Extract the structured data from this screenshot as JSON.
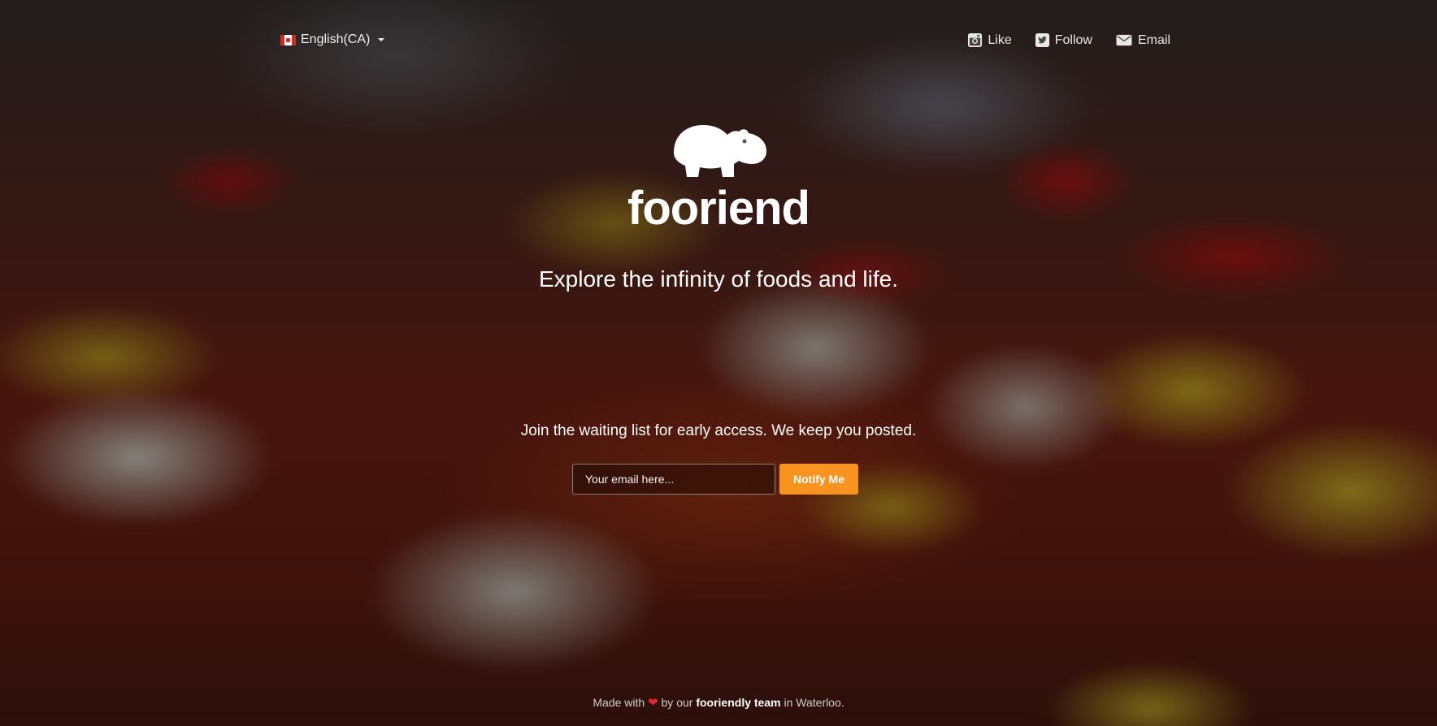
{
  "header": {
    "language": {
      "label": "English(CA)",
      "flag": "canada-flag-icon"
    },
    "social": [
      {
        "label": "Like",
        "icon": "instagram-icon"
      },
      {
        "label": "Follow",
        "icon": "twitter-icon"
      },
      {
        "label": "Email",
        "icon": "envelope-icon"
      }
    ]
  },
  "hero": {
    "brand": "fooriend",
    "tagline": "Explore the infinity of foods and life."
  },
  "signup": {
    "prompt": "Join the waiting list for early access. We keep you posted.",
    "email_placeholder": "Your email here...",
    "email_value": "",
    "button_label": "Notify Me"
  },
  "footer": {
    "prefix": "Made with",
    "middle": "by our",
    "team_link": "fooriendly team",
    "suffix": "in Waterloo."
  },
  "colors": {
    "accent": "#f7931e",
    "heart": "#e0262e"
  }
}
